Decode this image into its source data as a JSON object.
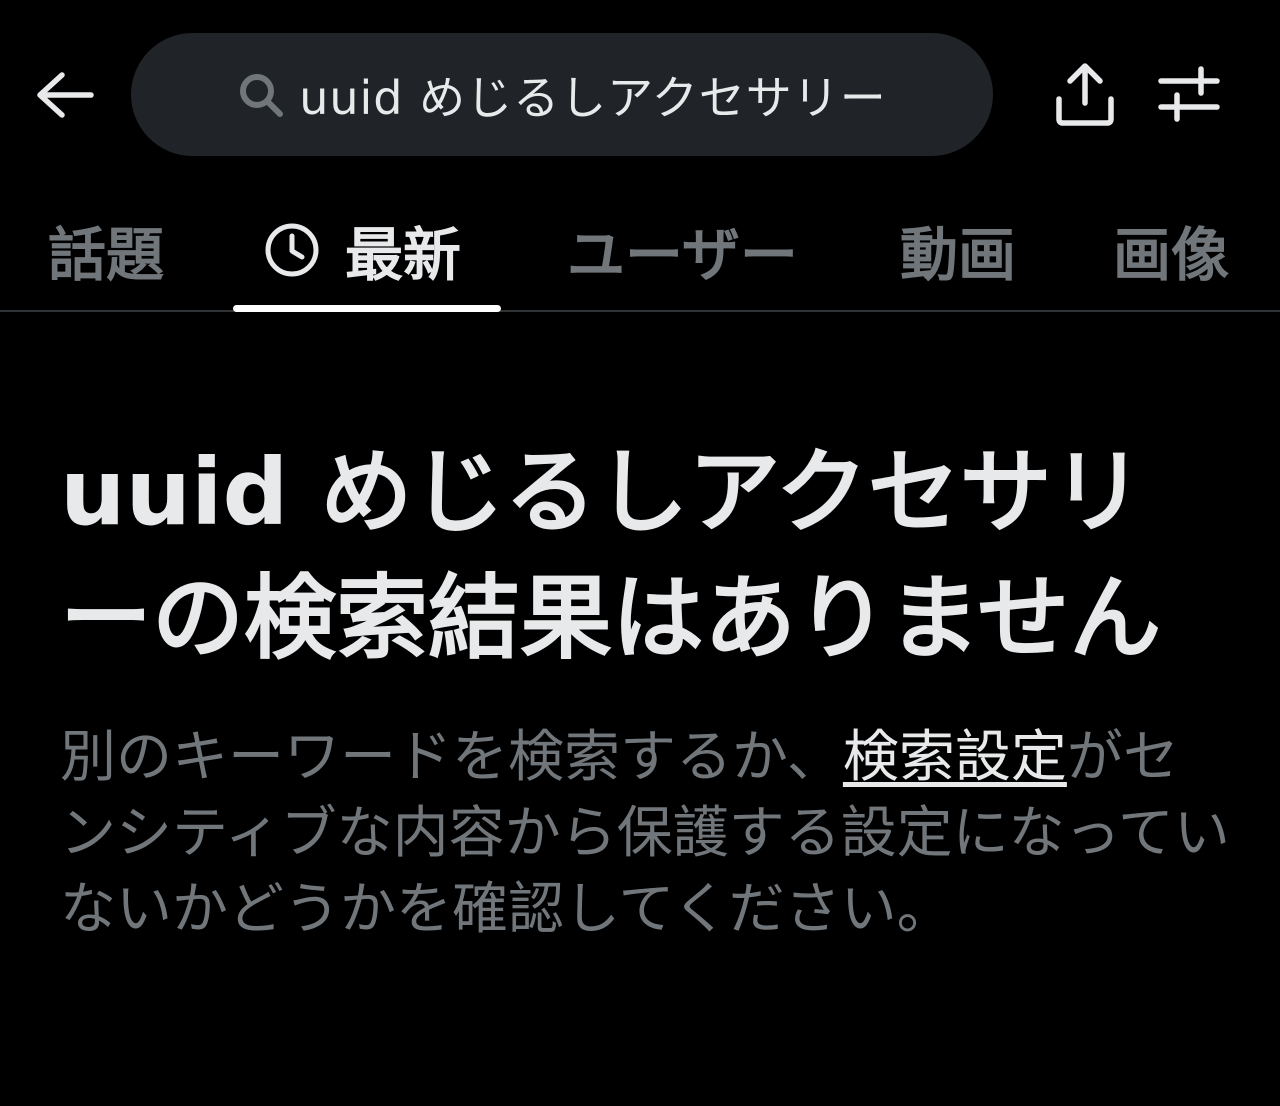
{
  "search": {
    "query": "uuid めじるしアクセサリー"
  },
  "tabs": [
    {
      "label": "話題"
    },
    {
      "label": "最新"
    },
    {
      "label": "ユーザー"
    },
    {
      "label": "動画"
    },
    {
      "label": "画像"
    }
  ],
  "active_tab": "最新",
  "empty_state": {
    "title": "uuid めじるしアクセサリーの検索結果はありません",
    "desc_before": "別のキーワードを検索するか、",
    "desc_link": "検索設定",
    "desc_after": "がセンシティブな内容から保護する設定になっていないかどうかを確認してください。"
  },
  "colors": {
    "background": "#000000",
    "search_bg": "#202327",
    "text_primary": "#e7e9ea",
    "text_secondary": "#71767b",
    "divider": "#2f3336"
  },
  "icons": [
    "back-arrow-icon",
    "search-icon",
    "share-icon",
    "filter-icon",
    "clock-icon"
  ]
}
